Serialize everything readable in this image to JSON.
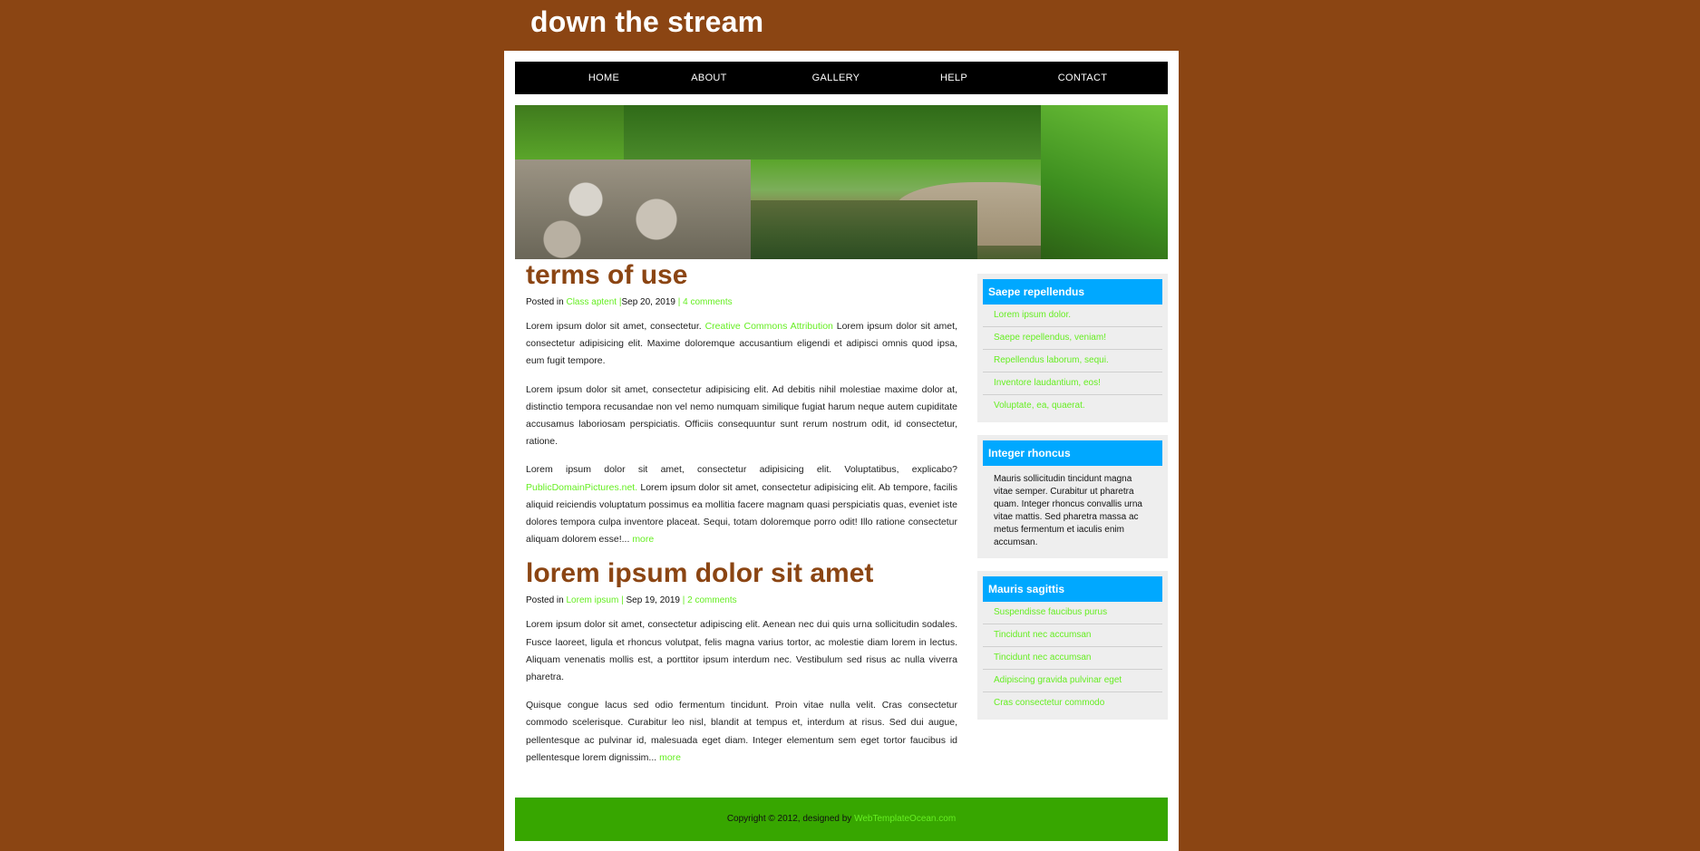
{
  "site": {
    "title": "down the stream"
  },
  "nav": [
    "HOME",
    "ABOUT",
    "GALLERY",
    "HELP",
    "CONTACT"
  ],
  "posts": [
    {
      "title": "terms of use",
      "meta": {
        "posted_in": "Posted in",
        "category": "Class aptent",
        "sep": "|",
        "date": "Sep 20, 2019",
        "sep2": "|",
        "comments": "4 comments"
      },
      "p1": {
        "a": "Lorem ipsum dolor sit amet, consectetur.",
        "link": "Creative Commons Attribution",
        "b": "Lorem ipsum dolor sit amet, consectetur adipisicing elit. Maxime doloremque accusantium eligendi et adipisci omnis quod ipsa, eum fugit tempore."
      },
      "p2": "Lorem ipsum dolor sit amet, consectetur adipisicing elit. Ad debitis nihil molestiae maxime dolor at, distinctio tempora recusandae non vel nemo numquam similique fugiat harum neque autem cupiditate accusamus laboriosam perspiciatis. Officiis consequuntur sunt rerum nostrum odit, id consectetur, ratione.",
      "p3": {
        "a": "Lorem ipsum dolor sit amet, consectetur adipisicing elit. Voluptatibus, explicabo?",
        "link": "PublicDomainPictures.net.",
        "b": "Lorem ipsum dolor sit amet, consectetur adipisicing elit. Ab tempore, facilis aliquid reiciendis voluptatum possimus ea mollitia facere magnam quasi perspiciatis quas, eveniet iste dolores tempora culpa inventore placeat. Sequi, totam doloremque porro odit! Illo ratione consectetur aliquam dolorem esse!...",
        "more": "more"
      }
    },
    {
      "title": "lorem ipsum dolor sit amet",
      "meta": {
        "posted_in": "Posted in",
        "category": "Lorem ipsum",
        "sep": "|",
        "date": "Sep 19, 2019",
        "sep2": "|",
        "comments": "2 comments"
      },
      "p1": "Lorem ipsum dolor sit amet, consectetur adipiscing elit. Aenean nec dui quis urna sollicitudin sodales. Fusce laoreet, ligula et rhoncus volutpat, felis magna varius tortor, ac molestie diam lorem in lectus. Aliquam venenatis mollis est, a porttitor ipsum interdum nec. Vestibulum sed risus ac nulla viverra pharetra.",
      "p2": {
        "a": "Quisque congue lacus sed odio fermentum tincidunt. Proin vitae nulla velit. Cras consectetur commodo scelerisque. Curabitur leo nisl, blandit at tempus et, interdum at risus. Sed dui augue, pellentesque ac pulvinar id, malesuada eget diam. Integer elementum sem eget tortor faucibus id pellentesque lorem dignissim...",
        "more": "more"
      }
    }
  ],
  "sidebar": {
    "box1": {
      "title": "Saepe repellendus",
      "items": [
        "Lorem ipsum dolor.",
        "Saepe repellendus, veniam!",
        "Repellendus laborum, sequi.",
        "Inventore laudantium, eos!",
        "Voluptate, ea, quaerat."
      ]
    },
    "box2": {
      "title": "Integer rhoncus",
      "text": "Mauris sollicitudin tincidunt magna vitae semper. Curabitur ut pharetra quam. Integer rhoncus convallis urna vitae mattis. Sed pharetra massa ac metus fermentum et iaculis enim accumsan."
    },
    "box3": {
      "title": "Mauris sagittis",
      "items": [
        "Suspendisse faucibus purus",
        "Tincidunt nec accumsan",
        "Tincidunt nec accumsan",
        "Adipiscing gravida pulvinar eget",
        "Cras consectetur commodo"
      ]
    }
  },
  "footer": {
    "text": "Copyright © 2012, designed by",
    "link": "WebTemplateOcean.com"
  },
  "colors": {
    "background": "#8b4513",
    "accent_link": "#66ee22",
    "title_brown": "#8b4513",
    "sidebar_header": "#00a8ff",
    "footer": "#37a600",
    "nav": "#000000"
  }
}
